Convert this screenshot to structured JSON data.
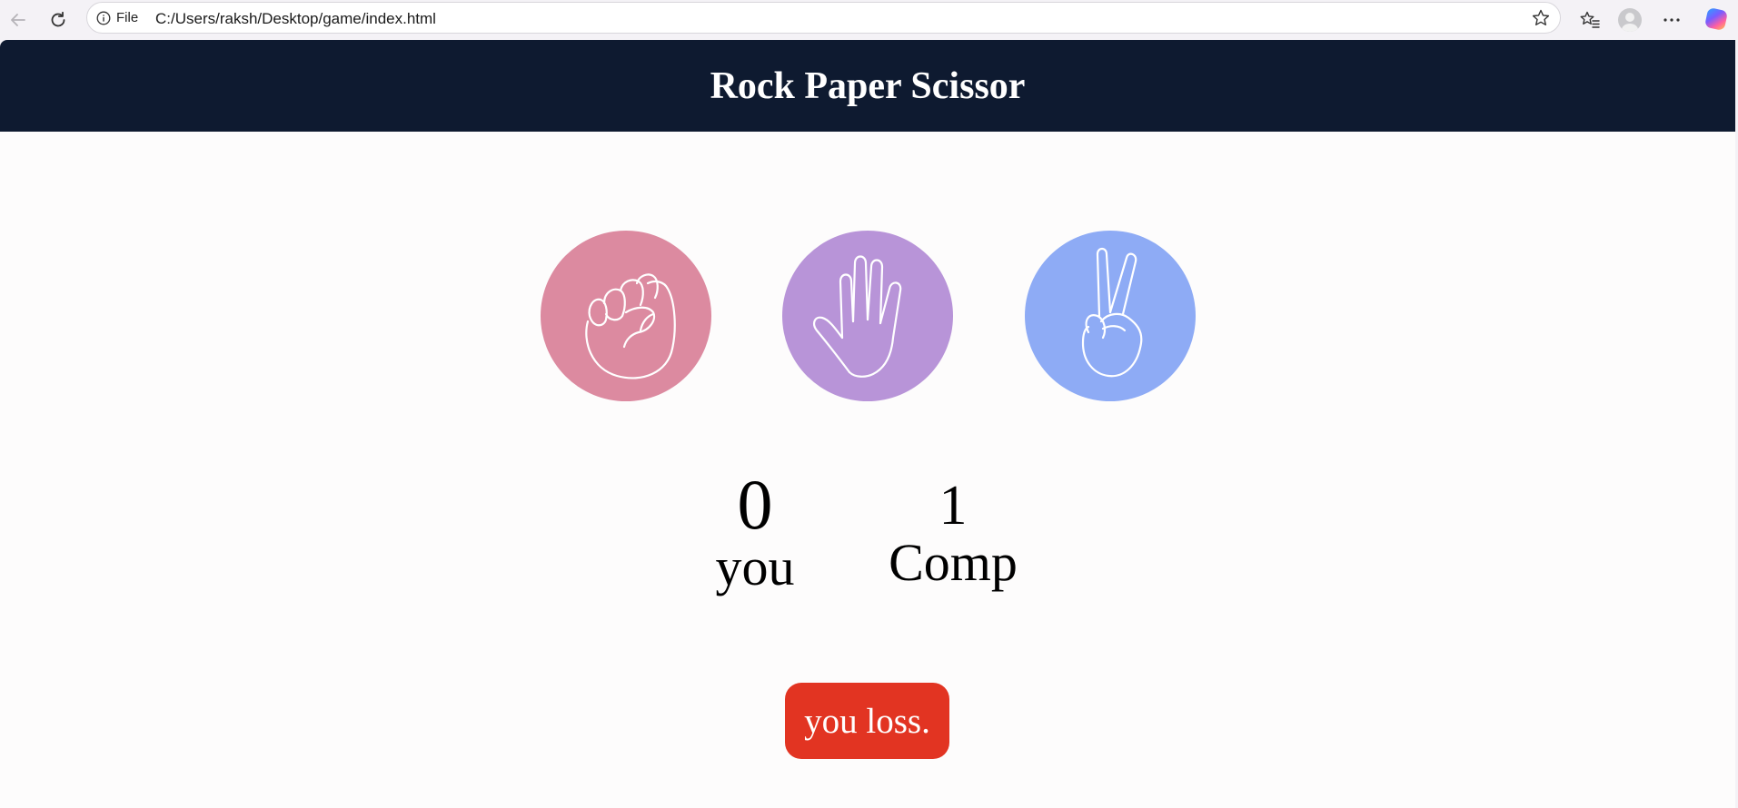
{
  "browser": {
    "address_prefix": "File",
    "url": "C:/Users/raksh/Desktop/game/index.html",
    "icons": [
      "back-arrow-icon",
      "refresh-icon",
      "info-icon",
      "star-icon",
      "favorites-icon",
      "profile-avatar-icon",
      "more-icon",
      "copilot-icon"
    ]
  },
  "page": {
    "title": "Rock Paper Scissor",
    "header_color": "#0e1a30",
    "choices": [
      {
        "id": "rock",
        "icon": "rock-fist-icon",
        "color": "#dc8aa0"
      },
      {
        "id": "paper",
        "icon": "paper-hand-icon",
        "color": "#b894d8"
      },
      {
        "id": "scissors",
        "icon": "scissors-hand-icon",
        "color": "#8eabf5"
      }
    ],
    "scores": {
      "user_score": "0",
      "user_label": "you",
      "comp_score": "1",
      "comp_label": "Comp"
    },
    "message": {
      "text": "you loss.",
      "color": "#e23422"
    }
  }
}
